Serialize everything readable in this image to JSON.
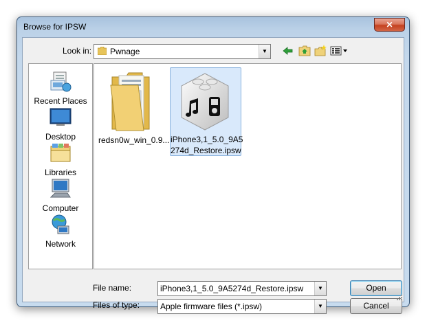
{
  "window": {
    "title": "Browse for IPSW",
    "close_symbol": "✕"
  },
  "toolbar": {
    "look_in_label": "Look in:",
    "look_in_value": "Pwnage",
    "icons": [
      "back-arrow-icon",
      "up-folder-icon",
      "new-folder-icon",
      "view-menu-icon"
    ]
  },
  "places": [
    {
      "label": "Recent Places",
      "icon": "recent-places-icon"
    },
    {
      "label": "Desktop",
      "icon": "desktop-icon"
    },
    {
      "label": "Libraries",
      "icon": "libraries-icon"
    },
    {
      "label": "Computer",
      "icon": "computer-icon"
    },
    {
      "label": "Network",
      "icon": "network-icon"
    }
  ],
  "files": [
    {
      "label": "redsn0w_win_0.9...",
      "icon": "folder-icon",
      "selected": false
    },
    {
      "label_line1": "iPhone3,1_5.0_9A5",
      "label_line2": "274d_Restore.ipsw",
      "icon": "ipsw-file-icon",
      "selected": true
    }
  ],
  "footer": {
    "file_name_label": "File name:",
    "file_name_value": "iPhone3,1_5.0_9A5274d_Restore.ipsw",
    "file_type_label": "Files of type:",
    "file_type_value": "Apple firmware files (*.ipsw)",
    "open_label": "Open",
    "cancel_label": "Cancel"
  },
  "colors": {
    "titlebar": "#bcd2e8",
    "selection": "#d9e9fb",
    "close": "#c4411f"
  }
}
